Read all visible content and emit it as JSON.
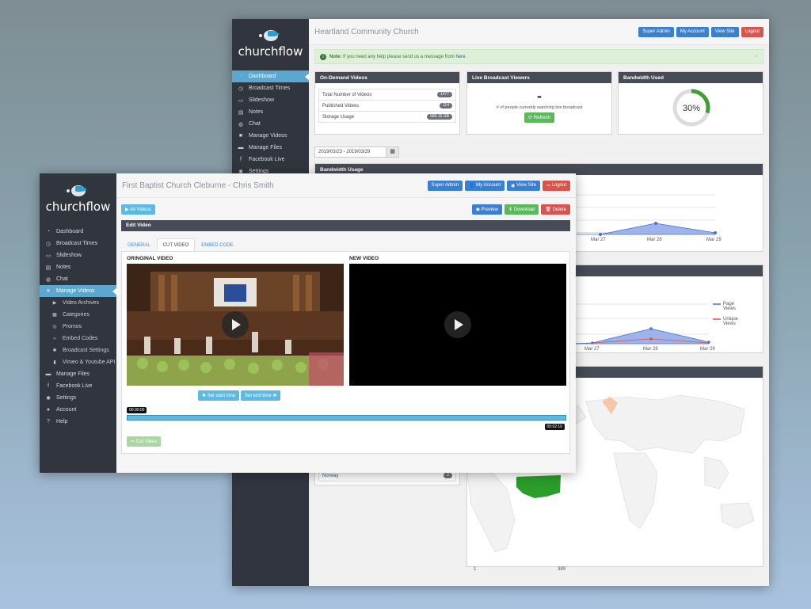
{
  "back": {
    "logo": "churchflow",
    "title": "Heartland Community Church",
    "buttons": [
      "Super Admin",
      "My Account",
      "View Site",
      "Logout"
    ],
    "nav": [
      "Dashboard",
      "Broadcast Times",
      "Slideshow",
      "Notes",
      "Chat",
      "Manage Videos",
      "Manage Files",
      "Facebook Live",
      "Settings"
    ],
    "alert_note": "Note:",
    "alert_text": "If you need any help please send us a message from",
    "alert_link": "here.",
    "alert_close": "×",
    "ondemand": {
      "title": "On-Demand Videos",
      "rows": [
        {
          "label": "Total Number of Videos",
          "value": "1477"
        },
        {
          "label": "Published Videos",
          "value": "114"
        },
        {
          "label": "Storage Usage",
          "value": "585.15 GB"
        }
      ]
    },
    "live": {
      "title": "Live Broadcast Viewers",
      "count": "-",
      "text": "# of people currently watching live broadcast",
      "refresh": "Refresh"
    },
    "bandwidth": {
      "title": "Bandwidth Used",
      "percent_label": "30%",
      "percent": 0.3
    },
    "date_range": "2019/03/23 - 2019/03/29",
    "bandwidth_usage_title": "Bandwidth Usage",
    "chart1_x": [
      "Mar 27",
      "Mar 28",
      "Mar 29"
    ],
    "chart2_x": [
      "Mar 27",
      "Mar 28",
      "Mar 29"
    ],
    "chart2_legend": [
      "Page Views",
      "Unique Views"
    ],
    "country": {
      "name": "Norway",
      "value": "2"
    },
    "map_scale_min": "1",
    "map_scale_max": "389"
  },
  "front": {
    "logo": "churchflow",
    "title": "First Baptist Church Cleburne - Chris Smith",
    "buttons": [
      "Super Admin",
      "My Account",
      "View Site",
      "Logout"
    ],
    "nav": [
      {
        "label": "Dashboard",
        "icon": "dashboard-icon",
        "sub": false
      },
      {
        "label": "Broadcast Times",
        "icon": "clock-icon",
        "sub": false
      },
      {
        "label": "Slideshow",
        "icon": "monitor-icon",
        "sub": false
      },
      {
        "label": "Notes",
        "icon": "notes-icon",
        "sub": false
      },
      {
        "label": "Chat",
        "icon": "chat-icon",
        "sub": false
      },
      {
        "label": "Manage Videos",
        "icon": "video-icon",
        "sub": false,
        "active": true
      },
      {
        "label": "Video Archives",
        "icon": "play-icon",
        "sub": true
      },
      {
        "label": "Categories",
        "icon": "grid-icon",
        "sub": true
      },
      {
        "label": "Promos",
        "icon": "target-icon",
        "sub": true
      },
      {
        "label": "Embed Codes",
        "icon": "code-icon",
        "sub": true
      },
      {
        "label": "Broadcast Settings",
        "icon": "gear-icon",
        "sub": true
      },
      {
        "label": "Vimeo & Youtube API",
        "icon": "lock-icon",
        "sub": true
      },
      {
        "label": "Manage Files",
        "icon": "folder-icon",
        "sub": false
      },
      {
        "label": "Facebook Live",
        "icon": "facebook-icon",
        "sub": false
      },
      {
        "label": "Settings",
        "icon": "gear-icon",
        "sub": false
      },
      {
        "label": "Account",
        "icon": "user-icon",
        "sub": false
      },
      {
        "label": "Help",
        "icon": "help-icon",
        "sub": false
      }
    ],
    "all_videos": "All Videos",
    "preview": "Preview",
    "download": "Download",
    "delete": "Delete",
    "edit_video": "Edit Video",
    "tabs": [
      "GENERAL",
      "CUT VIDEO",
      "EMBED CODE"
    ],
    "original_label": "ORINGINAL VIDEO",
    "new_label": "NEW VIDEO",
    "set_start": "Set start time",
    "set_end": "Set end time",
    "time_start": "00:00:00",
    "time_end": "00:02:10",
    "cut_video": "Cut Video"
  }
}
